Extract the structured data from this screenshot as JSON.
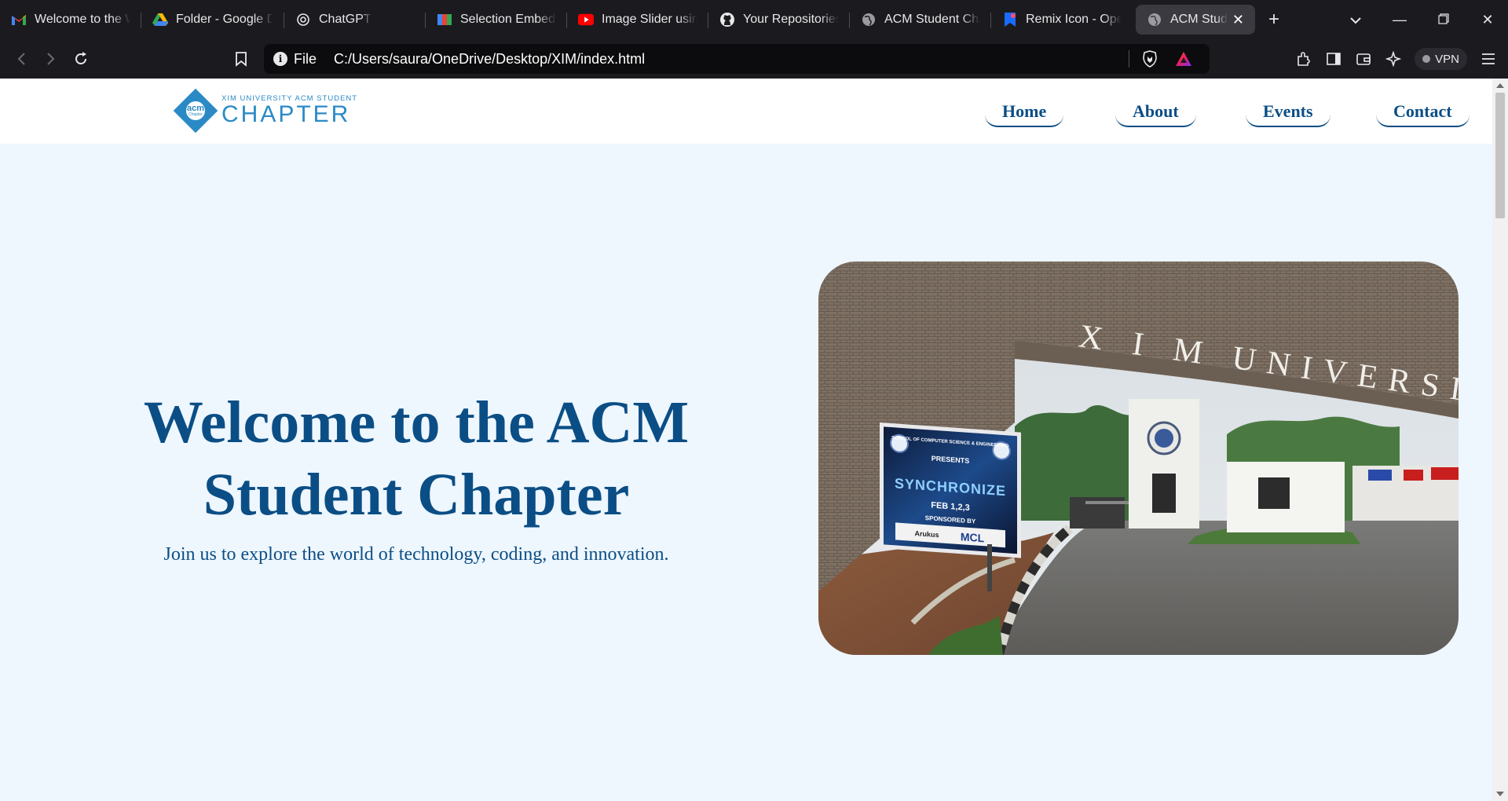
{
  "browser": {
    "tabs": [
      {
        "title": "Welcome to the W",
        "icon": "gmail-icon"
      },
      {
        "title": "Folder - Google D",
        "icon": "google-drive-icon"
      },
      {
        "title": "ChatGPT",
        "icon": "chatgpt-icon"
      },
      {
        "title": "Selection Embed C",
        "icon": "selection-embed-icon"
      },
      {
        "title": "Image Slider using",
        "icon": "youtube-icon"
      },
      {
        "title": "Your Repositories",
        "icon": "github-icon"
      },
      {
        "title": "ACM Student Cha",
        "icon": "globe-icon"
      },
      {
        "title": "Remix Icon - Ope",
        "icon": "remix-icon"
      },
      {
        "title": "ACM Student",
        "icon": "globe-icon",
        "active": true
      }
    ],
    "address": {
      "scheme_label": "File",
      "url": "C:/Users/saura/OneDrive/Desktop/XIM/index.html"
    },
    "vpn_label": "VPN"
  },
  "site": {
    "logo": {
      "circle_text": "acm",
      "circle_subtext": "Chapter",
      "small_text": "XIM University ACM Student",
      "big_text": "CHAPTER"
    },
    "nav": [
      "Home",
      "About",
      "Events",
      "Contact"
    ],
    "hero": {
      "title_line1": "Welcome to the ACM",
      "title_line2": "Student Chapter",
      "subtitle": "Join us to explore the world of technology, coding, and innovation."
    },
    "photo": {
      "gate_text": "X I M   UNIVERSITY",
      "banner_line1": "SCHOOL OF COMPUTER SCIENCE & ENGINEERING",
      "banner_line2": "PRESENTS",
      "banner_title": "SYNCHRONIZE",
      "banner_date": "FEB 1,2,3",
      "banner_sponsor": "SPONSORED BY",
      "sponsor_a": "Arukus",
      "sponsor_b": "MCL"
    }
  },
  "colors": {
    "brand_blue": "#0b4e85",
    "logo_blue": "#2b8ac6",
    "page_bg": "#eef6fe",
    "browser_bg": "#1b1b1f"
  }
}
